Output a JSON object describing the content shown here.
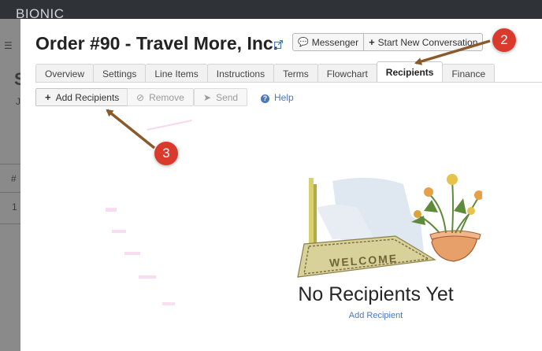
{
  "app": {
    "brand": "BIONIC"
  },
  "background_page": {
    "fragments": [
      {
        "name": "bg-fragment-menu",
        "text": "☰"
      },
      {
        "name": "bg-fragment-letter-s",
        "text": "S"
      },
      {
        "name": "bg-fragment-letter-j",
        "text": "J"
      },
      {
        "name": "bg-fragment-hash",
        "text": "#"
      },
      {
        "name": "bg-fragment-one",
        "text": "1"
      }
    ]
  },
  "modal": {
    "title": "Order #90 - Travel More, Inc.",
    "messenger_label": "Messenger",
    "new_conversation_label": "Start New Conversation"
  },
  "tabs": [
    "Overview",
    "Settings",
    "Line Items",
    "Instructions",
    "Terms",
    "Flowchart",
    "Recipients",
    "Finance"
  ],
  "active_tab": "Recipients",
  "toolbar": {
    "add_recipients_label": "Add Recipients",
    "remove_label": "Remove",
    "send_label": "Send",
    "help_label": "Help"
  },
  "empty_state": {
    "title": "No Recipients Yet",
    "link_label": "Add Recipient",
    "mat_text": "WELCOME"
  },
  "annotations": [
    {
      "label": "2",
      "target": "Recipients tab"
    },
    {
      "label": "3",
      "target": "Add Recipients button"
    }
  ],
  "colors": {
    "topbar": "#2f3236",
    "overlay": "#8a8a8a",
    "link": "#4a78b8",
    "badge": "#d93a2c",
    "arrow": "#8b5a2b"
  }
}
